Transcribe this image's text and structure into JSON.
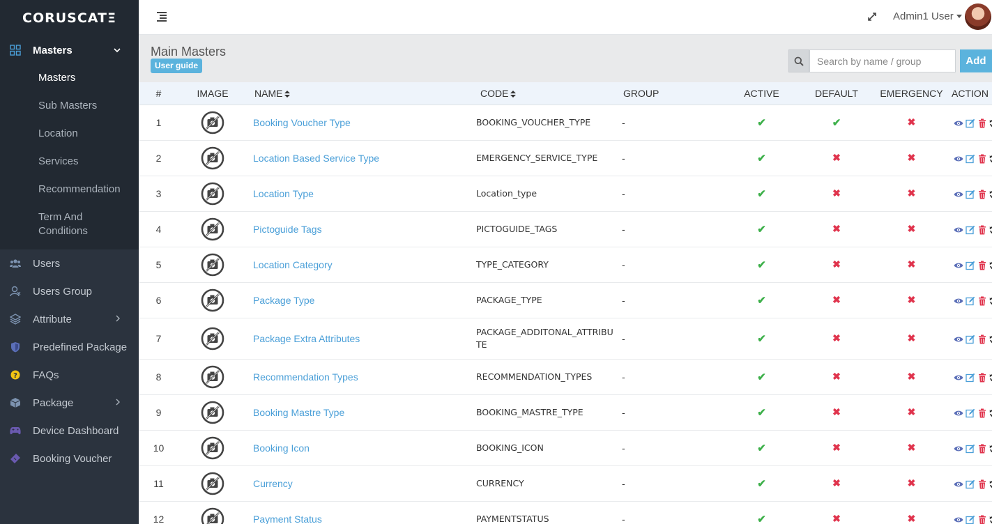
{
  "app": {
    "brand": "CORUSCATΞ"
  },
  "sidebar": {
    "items": [
      {
        "label": "Masters",
        "icon": "grid-icon"
      },
      {
        "label": "Users",
        "icon": "users-icon"
      },
      {
        "label": "Users Group",
        "icon": "user-group-icon"
      },
      {
        "label": "Attribute",
        "icon": "layers-icon"
      },
      {
        "label": "Predefined Package",
        "icon": "shield-icon"
      },
      {
        "label": "FAQs",
        "icon": "question-icon"
      },
      {
        "label": "Package",
        "icon": "box-icon"
      },
      {
        "label": "Device Dashboard",
        "icon": "gamepad-icon"
      },
      {
        "label": "Booking Voucher",
        "icon": "ticket-icon"
      }
    ],
    "submenu": [
      "Masters",
      "Sub Masters",
      "Location",
      "Services",
      "Recommendation",
      "Term And Conditions"
    ]
  },
  "topbar": {
    "user_name": "Admin1 User"
  },
  "header": {
    "title": "Main Masters",
    "guide_label": "User guide",
    "search_placeholder": "Search by name / group",
    "add_label": "Add"
  },
  "table": {
    "columns": [
      "#",
      "IMAGE",
      "NAME",
      "CODE",
      "GROUP",
      "ACTIVE",
      "DEFAULT",
      "EMERGENCY",
      "ACTION"
    ],
    "rows": [
      {
        "num": "1",
        "name": "Booking Voucher Type",
        "code": "BOOKING_VOUCHER_TYPE",
        "group": "-",
        "active": true,
        "default": true,
        "emergency": false
      },
      {
        "num": "2",
        "name": "Location Based Service Type",
        "code": "EMERGENCY_SERVICE_TYPE",
        "group": "-",
        "active": true,
        "default": false,
        "emergency": false
      },
      {
        "num": "3",
        "name": "Location Type",
        "code": "Location_type",
        "group": "-",
        "active": true,
        "default": false,
        "emergency": false
      },
      {
        "num": "4",
        "name": "Pictoguide Tags",
        "code": "PICTOGUIDE_TAGS",
        "group": "-",
        "active": true,
        "default": false,
        "emergency": false
      },
      {
        "num": "5",
        "name": "Location Category",
        "code": "TYPE_CATEGORY",
        "group": "-",
        "active": true,
        "default": false,
        "emergency": false
      },
      {
        "num": "6",
        "name": "Package Type",
        "code": "PACKAGE_TYPE",
        "group": "-",
        "active": true,
        "default": false,
        "emergency": false
      },
      {
        "num": "7",
        "name": "Package Extra Attributes",
        "code": "PACKAGE_ADDITONAL_ATTRIBUTE",
        "group": "-",
        "active": true,
        "default": false,
        "emergency": false
      },
      {
        "num": "8",
        "name": "Recommendation Types",
        "code": "RECOMMENDATION_TYPES",
        "group": "-",
        "active": true,
        "default": false,
        "emergency": false
      },
      {
        "num": "9",
        "name": "Booking Mastre Type",
        "code": "BOOKING_MASTRE_TYPE",
        "group": "-",
        "active": true,
        "default": false,
        "emergency": false
      },
      {
        "num": "10",
        "name": "Booking Icon",
        "code": "BOOKING_ICON",
        "group": "-",
        "active": true,
        "default": false,
        "emergency": false
      },
      {
        "num": "11",
        "name": "Currency",
        "code": "CURRENCY",
        "group": "-",
        "active": true,
        "default": false,
        "emergency": false
      },
      {
        "num": "12",
        "name": "Payment Status",
        "code": "PAYMENTSTATUS",
        "group": "-",
        "active": true,
        "default": false,
        "emergency": false
      }
    ],
    "check_glyph": "✔",
    "cross_glyph": "✖"
  },
  "colors": {
    "accent": "#5bb3dd",
    "link": "#4a9fd8",
    "yes": "#3db04a",
    "no": "#e0344d",
    "sidebar": "#2b333e"
  }
}
